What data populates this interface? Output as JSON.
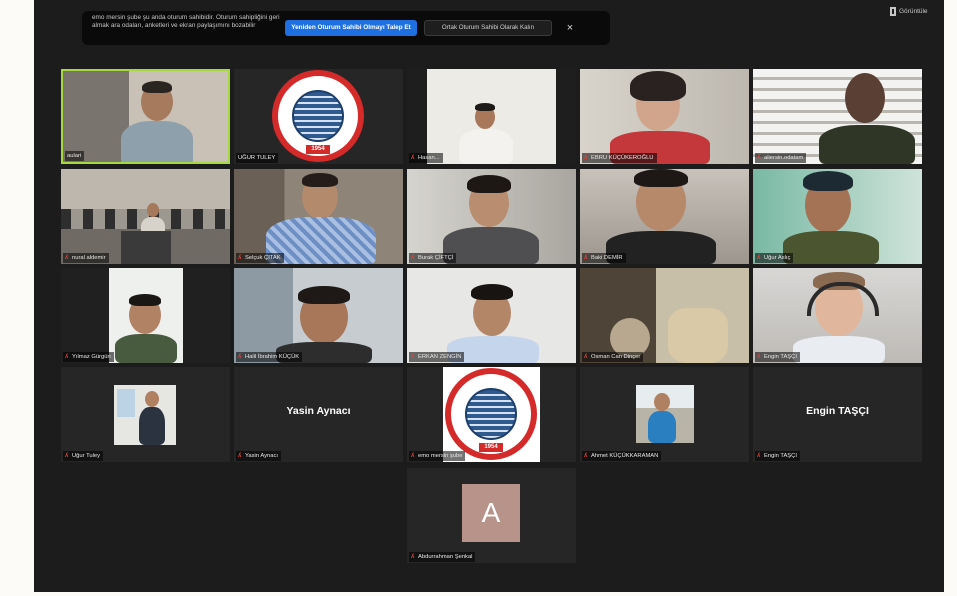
{
  "banner": {
    "message": "emo mersin şube şu anda oturum sahibidir. Oturum sahipliğini geri almak ara odaları, anketleri ve ekran paylaşımını bozabilir",
    "claim_button": "Yeniden Oturum Sahibi Olmayı Talep Et",
    "stay_button": "Ortak Oturum Sahibi Olarak Kalın",
    "close_glyph": "×"
  },
  "view": {
    "label": "Görüntüle"
  },
  "participants": [
    {
      "name": "aulari"
    },
    {
      "name": "UĞUR TULEY"
    },
    {
      "name": "Hasan..."
    },
    {
      "name": "EBRU KÜÇÜKEROĞLU"
    },
    {
      "name": "aliersin.odatam"
    },
    {
      "name": "nural aldemir"
    },
    {
      "name": "Selçuk ÇITAK"
    },
    {
      "name": "Burak ÇİFTÇİ"
    },
    {
      "name": "Baki DEMİR"
    },
    {
      "name": "Uğur Aslıç"
    },
    {
      "name": "Yılmaz Gürgün"
    },
    {
      "name": "Halil İbrahim KÜÇÜK"
    },
    {
      "name": "ERKAN ZENGİN"
    },
    {
      "name": "Osman Can Dinçer"
    },
    {
      "name": "Engin TAŞÇI"
    },
    {
      "name": "Uğur Tuley"
    },
    {
      "name": "Yasin Aynacı",
      "display": "Yasin Aynacı"
    },
    {
      "name": "emo mersin şube"
    },
    {
      "name": "Ahmet KÜÇÜKKARAMAN"
    },
    {
      "name": "Engin TAŞÇI",
      "display": "Engin TAŞÇI"
    },
    {
      "name": "Abdurrahman Şenkal",
      "avatar": "A"
    }
  ],
  "colors": {
    "active_border": "#a6d93f",
    "muted_mic": "#e0463c",
    "primary_button": "#1e6fe0"
  }
}
